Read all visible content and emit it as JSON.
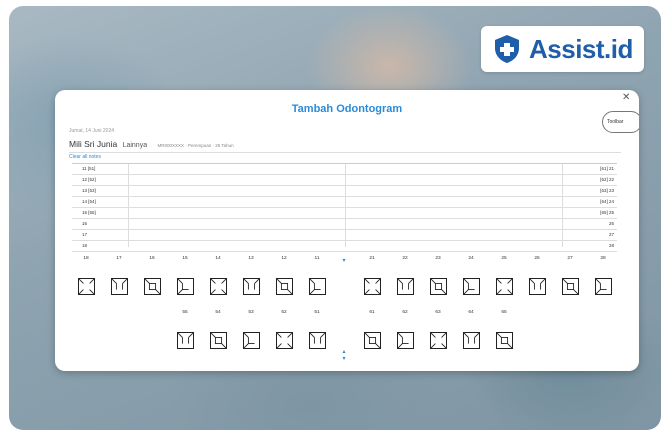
{
  "brand": {
    "name": "Assist.id",
    "accent": "#1f5ea8"
  },
  "modal": {
    "title": "Tambah Odontogram",
    "toolbar_label": "Toolbar",
    "close_icon": "close-icon",
    "date": "Jumat, 14 Juni 2024",
    "patient_name": "Mili Sri Junia",
    "patient_tag": "Lainnya",
    "patient_meta": "MR000XXXX · Perempuan · 25 Tahun",
    "clear_label": "Clear all notes"
  },
  "table_rows": [
    {
      "left": "11 [51]",
      "right": "[61] 21"
    },
    {
      "left": "12 [52]",
      "right": "[62] 22"
    },
    {
      "left": "13 [53]",
      "right": "[63] 23"
    },
    {
      "left": "14 [54]",
      "right": "[64] 24"
    },
    {
      "left": "15 [55]",
      "right": "[65] 25"
    },
    {
      "left": "16",
      "right": "26"
    },
    {
      "left": "17",
      "right": "27"
    },
    {
      "left": "18",
      "right": "28"
    }
  ],
  "adult_upper": [
    "18",
    "17",
    "16",
    "15",
    "14",
    "13",
    "12",
    "11",
    "21",
    "22",
    "23",
    "24",
    "25",
    "26",
    "27",
    "28"
  ],
  "child_upper": [
    "55",
    "54",
    "53",
    "52",
    "51",
    "61",
    "62",
    "63",
    "64",
    "65"
  ],
  "child_lower_count": 10
}
